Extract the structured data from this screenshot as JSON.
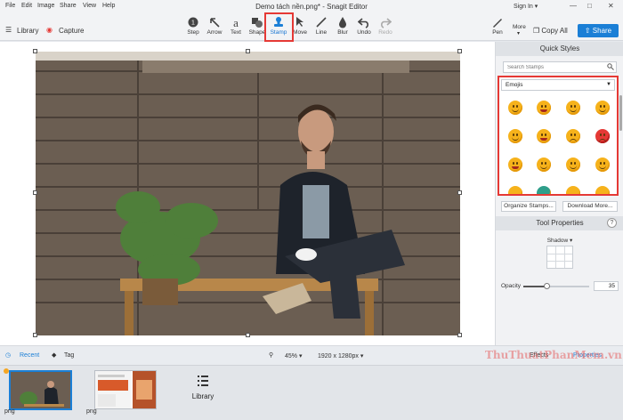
{
  "menu": [
    "File",
    "Edit",
    "Image",
    "Share",
    "View",
    "Help"
  ],
  "window_title": "Demo tách nền.png* - Snagit Editor",
  "account": {
    "sign_in": "Sign In ▾"
  },
  "toolbar": {
    "library_label": "Library",
    "capture_label": "Capture",
    "tools": [
      "Step",
      "Arrow",
      "Text",
      "Shape",
      "Stamp",
      "Move",
      "Line",
      "Blur",
      "Undo",
      "Redo"
    ],
    "pen_label": "Pen",
    "more_label": "More",
    "copy_all_label": "Copy All",
    "share_label": "Share"
  },
  "panel": {
    "quick_styles_title": "Quick Styles",
    "search_placeholder": "Search Stamps",
    "category": "Emojis",
    "organize_label": "Organize Stamps...",
    "download_label": "Download More...",
    "tool_properties_title": "Tool Properties",
    "help_label": "?",
    "shadow_label": "Shadow ▾",
    "opacity_label": "Opacity",
    "opacity_value": "35"
  },
  "status": {
    "recent_label": "Recent",
    "tag_label": "Tag",
    "zoom_label": "45% ▾",
    "size_label": "1920 x 1280px ▾",
    "effects_label": "Effects",
    "properties_label": "Properties"
  },
  "tray": {
    "thumb1_label": "png",
    "thumb2_label": "png",
    "library_label": "Library"
  },
  "watermark": "ThuThuatPhanMem.vn",
  "colors": {
    "accent": "#1b7fd6",
    "highlight": "#e53935",
    "emoji": "#f6b21b"
  }
}
